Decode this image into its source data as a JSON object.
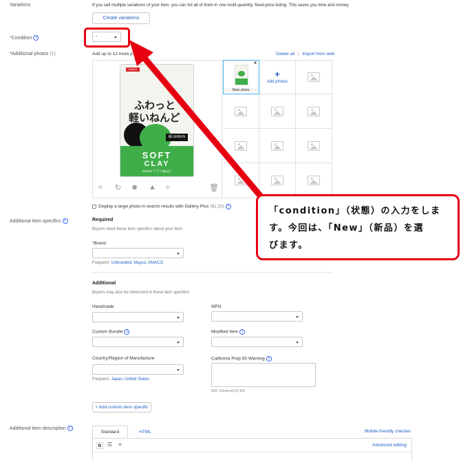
{
  "variations": {
    "label": "Variations",
    "description": "If you sell multiple variations of your item, you can list all of them in one multi-quantity, fixed-price listing. This saves you time and money.",
    "button": "Create variations"
  },
  "condition": {
    "label": "*Condition",
    "value": "-"
  },
  "photos": {
    "label": "*Additional photos",
    "count": "(1)",
    "hint": "Add up to 12 more p",
    "delete_all": "Delete all",
    "divider": "|",
    "import_web": "Import from web",
    "main_photo_label": "Main photo",
    "remove_mark": "x",
    "add_plus": "+",
    "add_label": "Add photos",
    "product": {
      "tag": "DAISO",
      "line1": "ふわっと",
      "line2": "軽いねんど",
      "green_label": "緑 GREEN",
      "brand1": "SOFT",
      "brand2": "CLAY",
      "maker": "DAISO ソフトねんど"
    },
    "gallery_plus": "Display a large photo in search results with Gallery Plus",
    "gallery_price": "($2.20)"
  },
  "item_specifics": {
    "label": "Additional item specifics",
    "required_heading": "Required",
    "required_desc": "Buyers need these item specifics about your item",
    "brand_label": "*Brand",
    "brand_frequent_prefix": "Frequent:",
    "brand_frequent": "Unbranded, Mayco, AMACO",
    "additional_heading": "Additional",
    "additional_desc": "Buyers may also be interested in these item specifics",
    "handmade": "Handmade",
    "mpn": "MPN",
    "custom_bundle": "Custom Bundle",
    "modified_item": "Modified Item",
    "country": "Country/Region of Manufacture",
    "country_frequent_prefix": "Frequent:",
    "country_frequent": "Japan, United States",
    "prop65": "California Prop 65 Warning",
    "chars_left": "800 character(s) left",
    "add_custom": "+ Add custom item specific"
  },
  "description": {
    "label": "Additional item description",
    "tab_standard": "Standard",
    "tab_html": "HTML",
    "mobile_checker": "Mobile-friendly checker",
    "advanced_editing": "Advanced editing",
    "bold": "B"
  },
  "callout": {
    "line1": "「condition」（状態）の入力をしま",
    "line2": "す。今回は、「New」（新品）を選",
    "line3": "びます。"
  },
  "colors": {
    "accent": "#e60012",
    "link": "#1f5fc4",
    "info": "#3665f3",
    "product_green": "#3fae49"
  }
}
